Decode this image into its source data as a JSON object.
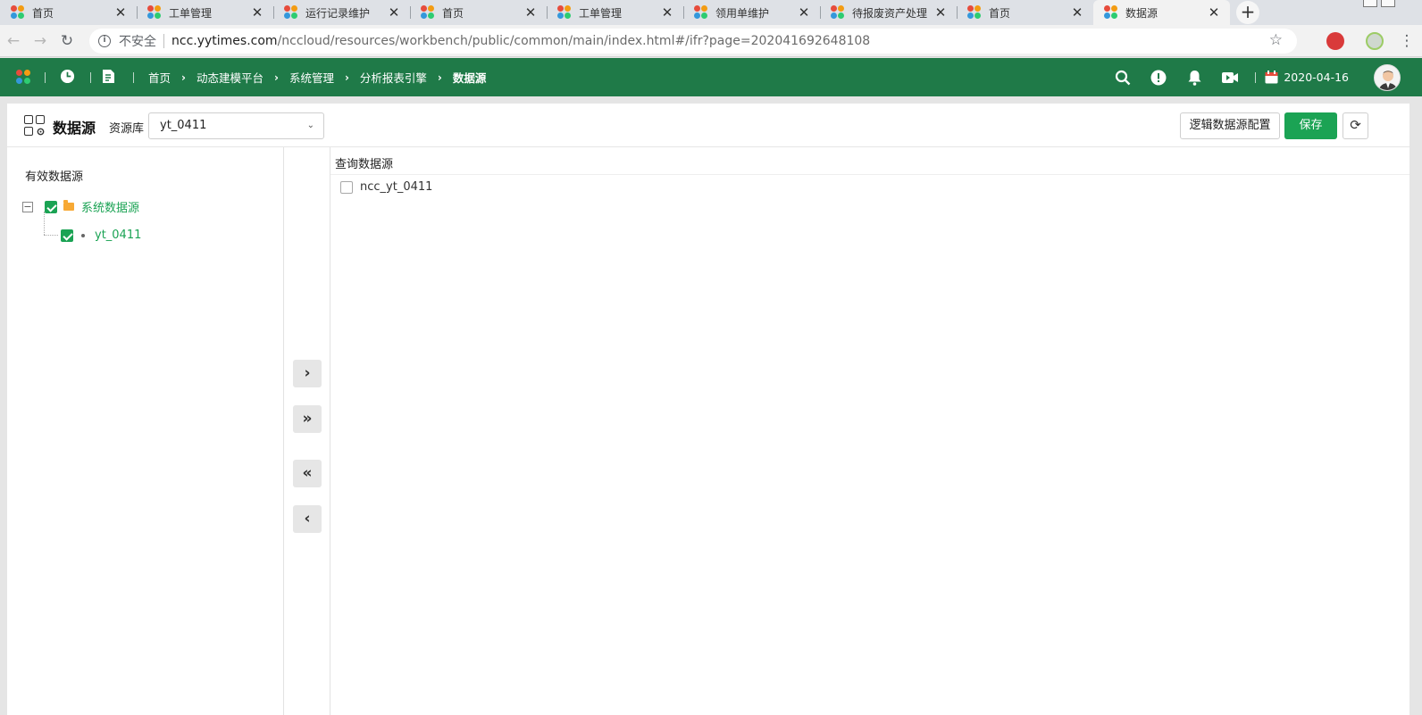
{
  "browser": {
    "tabs": [
      {
        "title": "首页",
        "active": false
      },
      {
        "title": "工单管理",
        "active": false
      },
      {
        "title": "运行记录维护",
        "active": false
      },
      {
        "title": "首页",
        "active": false
      },
      {
        "title": "工单管理",
        "active": false
      },
      {
        "title": "领用单维护",
        "active": false
      },
      {
        "title": "待报废资产处理",
        "active": false
      },
      {
        "title": "首页",
        "active": false
      },
      {
        "title": "数据源",
        "active": true
      }
    ],
    "close_glyph": "✕",
    "new_tab": "+",
    "security_label": "不安全",
    "url_host": "ncc.yytimes.com",
    "url_path": "/nccloud/resources/workbench/public/common/main/index.html#/ifr?page=202041692648108"
  },
  "app_header": {
    "breadcrumbs": [
      "首页",
      "动态建模平台",
      "系统管理",
      "分析报表引擎",
      "数据源"
    ],
    "crumb_separator": "›",
    "date": "2020-04-16",
    "icons": [
      "logo-icon",
      "clock-icon",
      "document-icon",
      "search-icon",
      "alert-icon",
      "bell-icon",
      "video-icon",
      "calendar-icon",
      "user-avatar"
    ]
  },
  "page": {
    "title": "数据源",
    "library_label": "资源库",
    "library_value": "yt_0411",
    "buttons": {
      "config": "逻辑数据源配置",
      "save": "保存",
      "refresh_glyph": "⟳"
    }
  },
  "left_panel": {
    "title": "有效数据源",
    "tree": {
      "root": {
        "label": "系统数据源",
        "checked": true,
        "expanded": true,
        "expander": "−"
      },
      "children": [
        {
          "label": "yt_0411",
          "checked": true
        }
      ]
    }
  },
  "transfer_buttons": [
    "›",
    "»",
    "«",
    "‹"
  ],
  "right_panel": {
    "title": "查询数据源",
    "items": [
      {
        "label": "ncc_yt_0411",
        "checked": false
      }
    ]
  },
  "colors": {
    "header_green": "#1f7a48",
    "accent_green": "#1ba354",
    "folder_orange": "#f7a935"
  }
}
